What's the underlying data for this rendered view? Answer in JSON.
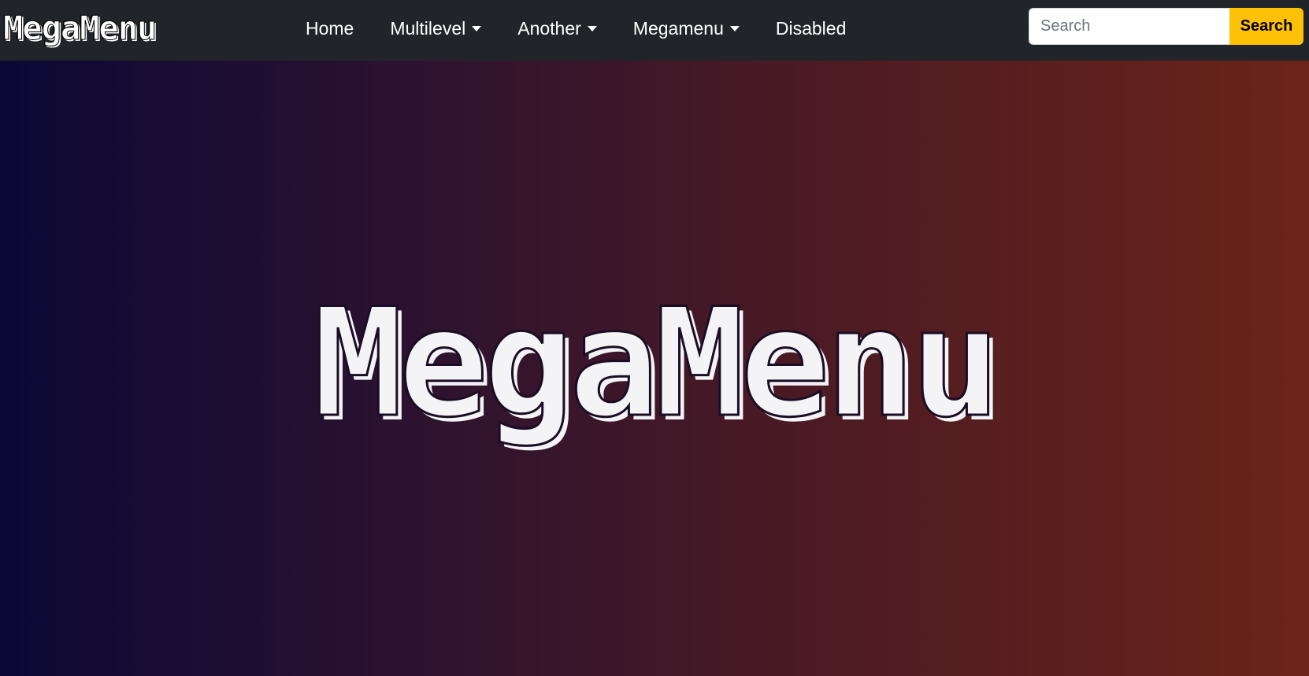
{
  "navbar": {
    "brand": "MegaMenu",
    "items": [
      {
        "label": "Home",
        "dropdown": false
      },
      {
        "label": "Multilevel",
        "dropdown": true
      },
      {
        "label": "Another",
        "dropdown": true
      },
      {
        "label": "Megamenu",
        "dropdown": true
      },
      {
        "label": "Disabled",
        "dropdown": false,
        "disabled": true
      }
    ],
    "search": {
      "placeholder": "Search",
      "value": "",
      "button_label": "Search"
    }
  },
  "hero": {
    "title": "MegaMenu"
  },
  "colors": {
    "navbar_bg": "#212529",
    "search_button": "#ffc107",
    "gradient_start": "#0b0836",
    "gradient_end": "#6b2419"
  }
}
